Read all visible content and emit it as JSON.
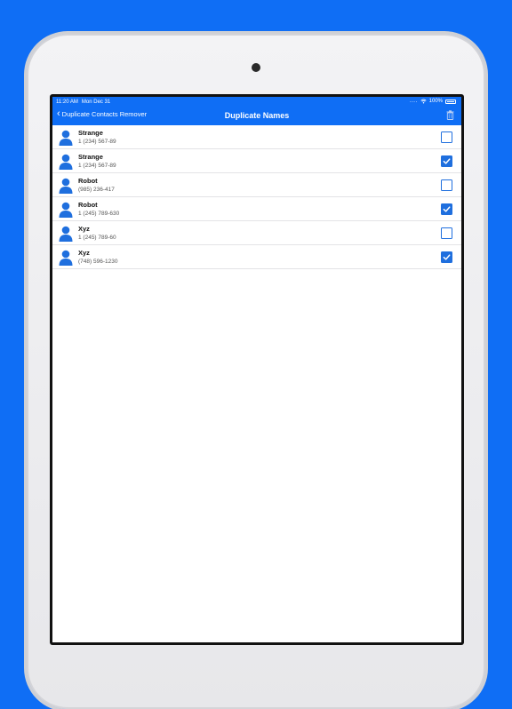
{
  "statusbar": {
    "time": "11:20 AM",
    "date": "Mon Dec 31",
    "battery": "100%"
  },
  "navbar": {
    "back_label": "Duplicate Contacts Remover",
    "title": "Duplicate Names",
    "action_icon": "trash-icon"
  },
  "colors": {
    "accent": "#0f6ef5",
    "check": "#1f6fde",
    "background": "#0f6ef5"
  },
  "contacts": [
    {
      "name": "Strange",
      "phone": "1 (234) 567-89",
      "checked": false
    },
    {
      "name": "Strange",
      "phone": "1 (234) 567-89",
      "checked": true
    },
    {
      "name": "Robot",
      "phone": "(985) 236-417",
      "checked": false
    },
    {
      "name": "Robot",
      "phone": "1 (245) 789-630",
      "checked": true
    },
    {
      "name": "Xyz",
      "phone": "1 (245) 789-60",
      "checked": false
    },
    {
      "name": "Xyz",
      "phone": "(748) 596-1230",
      "checked": true
    }
  ]
}
